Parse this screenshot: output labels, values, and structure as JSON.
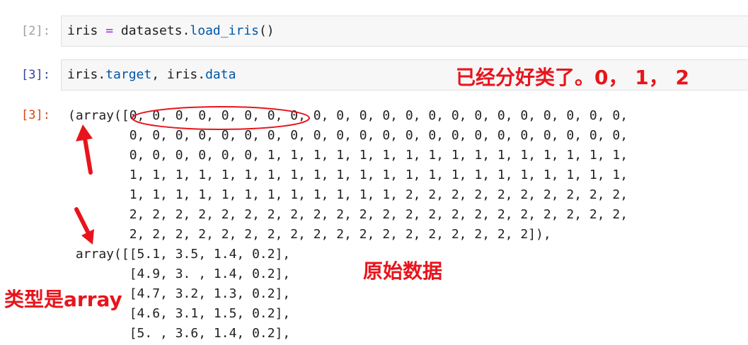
{
  "cells": [
    {
      "prompt": "[2]:",
      "code_parts": [
        "iris",
        " = ",
        "datasets.",
        "load_iris",
        "()"
      ]
    },
    {
      "prompt": "[3]:",
      "code_parts": [
        "iris.",
        "target",
        ", iris.",
        "data"
      ]
    }
  ],
  "output": {
    "prompt": "[3]:",
    "lines": [
      "(array([0, 0, 0, 0, 0, 0, 0, 0, 0, 0, 0, 0, 0, 0, 0, 0, 0, 0, 0, 0, 0, 0,",
      "        0, 0, 0, 0, 0, 0, 0, 0, 0, 0, 0, 0, 0, 0, 0, 0, 0, 0, 0, 0, 0, 0,",
      "        0, 0, 0, 0, 0, 0, 1, 1, 1, 1, 1, 1, 1, 1, 1, 1, 1, 1, 1, 1, 1, 1,",
      "        1, 1, 1, 1, 1, 1, 1, 1, 1, 1, 1, 1, 1, 1, 1, 1, 1, 1, 1, 1, 1, 1,",
      "        1, 1, 1, 1, 1, 1, 1, 1, 1, 1, 1, 1, 2, 2, 2, 2, 2, 2, 2, 2, 2, 2,",
      "        2, 2, 2, 2, 2, 2, 2, 2, 2, 2, 2, 2, 2, 2, 2, 2, 2, 2, 2, 2, 2, 2,",
      "        2, 2, 2, 2, 2, 2, 2, 2, 2, 2, 2, 2, 2, 2, 2, 2, 2, 2]),",
      " array([[5.1, 3.5, 1.4, 0.2],",
      "        [4.9, 3. , 1.4, 0.2],",
      "        [4.7, 3.2, 1.3, 0.2],",
      "        [4.6, 3.1, 1.5, 0.2],",
      "        [5. , 3.6, 1.4, 0.2],"
    ]
  },
  "annotations": {
    "classified": "已经分好类了。0， 1， 2",
    "raw_data": "原始数据",
    "type_is_array": "类型是array"
  },
  "colors": {
    "annotation_red": "#e8141c",
    "prompt_in": "#303f9f",
    "prompt_out": "#d84315"
  }
}
